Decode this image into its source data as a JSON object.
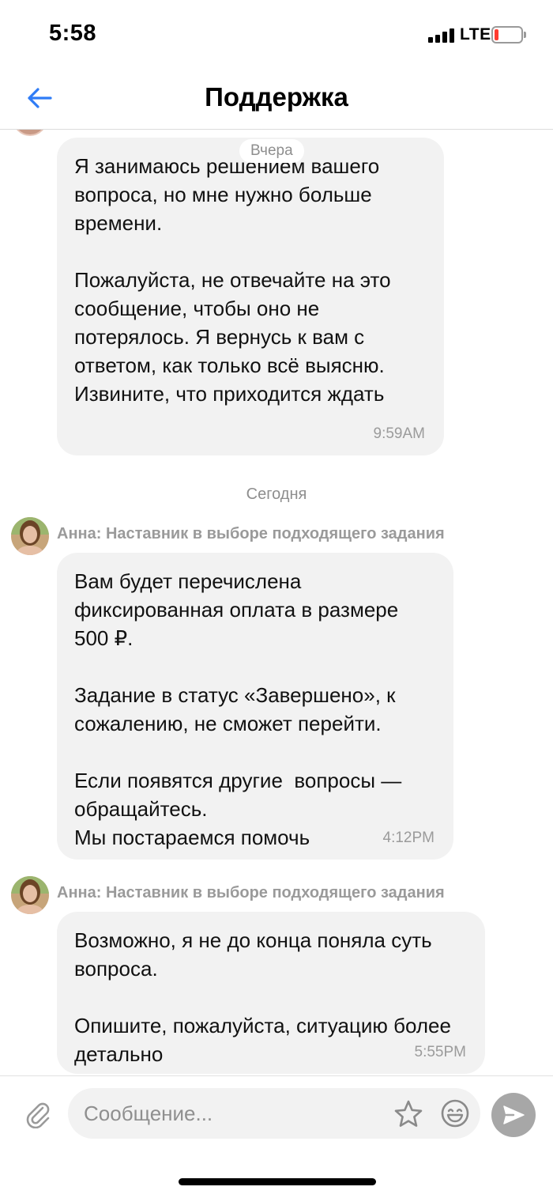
{
  "status_bar": {
    "time": "5:58",
    "network": "LTE",
    "battery_level": 0.12,
    "battery_color": "#ff3b30"
  },
  "nav": {
    "back_icon": "arrow-left-icon",
    "title": "Поддержка",
    "accent_color": "#2f7cf6"
  },
  "chat": {
    "date_yesterday": "Вчера",
    "date_today": "Сегодня",
    "messages": [
      {
        "sender": "",
        "text": "Я занимаюсь решением вашего вопроса, но мне нужно больше времени.\n\nПожалуйста, не отвечайте на это сообщение, чтобы оно не потерялось. Я вернусь к вам с ответом, как только всё выясню. Извините, что приходится ждать",
        "time": "9:59AM"
      },
      {
        "sender": "Анна: Наставник в выборе подходящего задания",
        "text": "Вам будет перечислена фиксированная оплата в размере 500 ₽.\n\nЗадание в статус «Завершено», к сожалению, не сможет перейти.\n\nЕсли появятся другие  вопросы — обращайтесь.\nМы постараемся помочь",
        "time": "4:12PM"
      },
      {
        "sender": "Анна: Наставник в выборе подходящего задания",
        "text": "Возможно, я не до конца поняла суть вопроса.\n\nОпишите, пожалуйста, ситуацию более детально",
        "time": "5:55PM"
      }
    ]
  },
  "input_bar": {
    "placeholder": "Сообщение...",
    "value": "",
    "attach_icon": "paperclip-icon",
    "star_icon": "star-icon",
    "emoji_icon": "smiley-icon",
    "send_icon": "send-icon"
  }
}
